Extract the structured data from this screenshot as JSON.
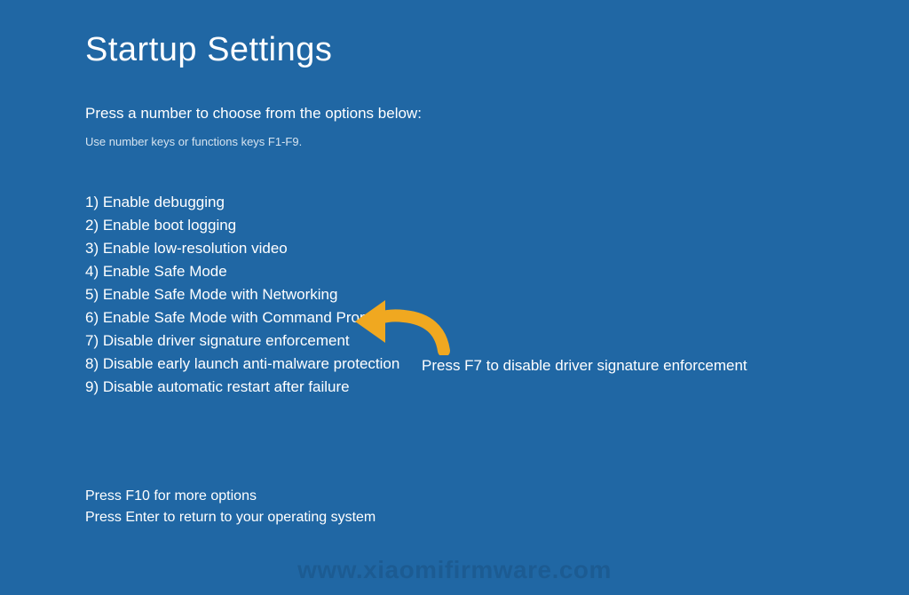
{
  "title": "Startup Settings",
  "instruction": "Press a number to choose from the options below:",
  "hint": "Use number keys or functions keys F1-F9.",
  "options": [
    "1) Enable debugging",
    "2) Enable boot logging",
    "3) Enable low-resolution video",
    "4) Enable Safe Mode",
    "5) Enable Safe Mode with Networking",
    "6) Enable Safe Mode with Command Prompt",
    "7) Disable driver signature enforcement",
    "8) Disable early launch anti-malware protection",
    "9) Disable automatic restart after failure"
  ],
  "footer": {
    "line1": "Press F10 for more options",
    "line2": "Press Enter to return to your operating system"
  },
  "annotation": "Press F7 to disable driver signature enforcement",
  "watermark": "www.xiaomifirmware.com",
  "colors": {
    "arrow": "#f0a820"
  }
}
